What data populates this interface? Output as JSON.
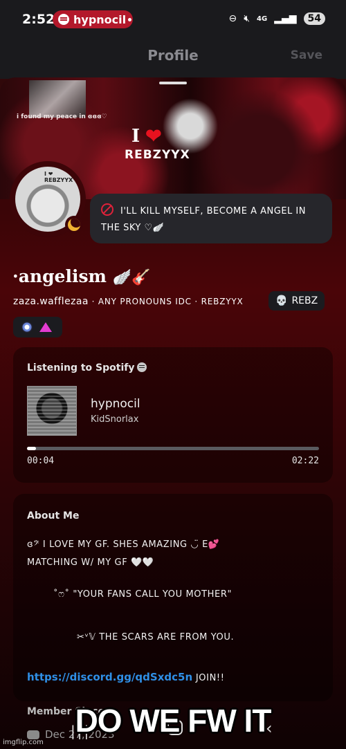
{
  "status_bar": {
    "time": "2:52",
    "now_playing_pill": "hypnocil",
    "network": "4G",
    "battery": "54"
  },
  "header": {
    "title": "Profile",
    "save_label": "Save"
  },
  "banner": {
    "caption": "i found my peace in ɞɞɞ♡",
    "i_text": "I",
    "name": "REBZYYX"
  },
  "avatar": {
    "label": "I ❤ REBZYYX"
  },
  "custom_status": {
    "text": "I'LL KILL MYSELF, BECOME A ANGEL IN THE SKY ♡🪽"
  },
  "profile": {
    "display_name": "·angelism",
    "display_name_deco": "🪽🎸",
    "username": "zaza.wafflezaa",
    "pronouns": "· ANY PRONOUNS IDC · REBZYYX",
    "tag": "REBZ"
  },
  "spotify": {
    "title": "Listening to Spotify",
    "track": "hypnocil",
    "artist": "KidSnorlax",
    "elapsed": "00:04",
    "duration": "02:22",
    "progress": 0.03
  },
  "about": {
    "title": "About Me",
    "line1": "ɞ𝄢 I LOVE MY GF. SHES AMAZING ◡̈ E💕",
    "line2": "MATCHING W/ MY GF 🤍🤍",
    "line3": "˚ෆ˚ \"YOUR FANS CALL YOU MOTHER\"",
    "line4": "✂ᵛ𝕍 THE SCARS ARE FROM YOU.",
    "link": "https://discord.gg/qdSxdc5n",
    "link_suffix": "JOIN!!"
  },
  "member": {
    "label": "Member Since",
    "date": "Dec 27, 2023"
  },
  "overlay": {
    "meme_text": "DO WE FW IT",
    "watermark": "imgflip.com"
  }
}
